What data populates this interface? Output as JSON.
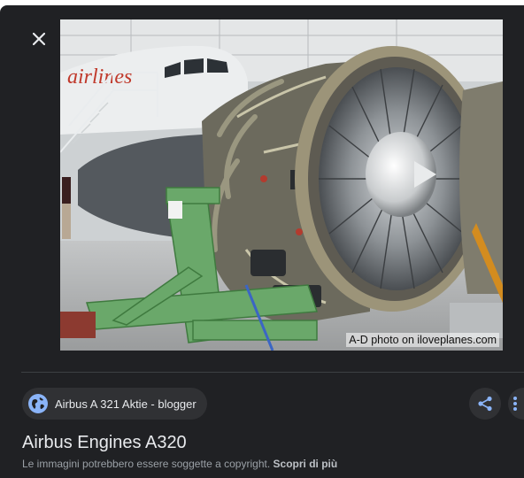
{
  "viewer": {
    "close_icon": "close-icon",
    "image": {
      "alt": "Airbus Engines A320",
      "watermark": "A-D photo on iloveplanes.com"
    }
  },
  "source": {
    "icon": "globe-icon",
    "label": "Airbus A 321 Aktie - blogger"
  },
  "actions": {
    "share_icon": "share-icon",
    "more_icon": "more-vert-icon"
  },
  "details": {
    "title": "Airbus Engines A320",
    "copyright_text": "Le immagini potrebbero essere soggette a copyright.",
    "learn_more": "Scopri di più"
  },
  "colors": {
    "background": "#202124",
    "chip": "#303134",
    "accent": "#8ab4f8",
    "text_primary": "#e8eaed",
    "text_secondary": "#9aa0a6"
  }
}
